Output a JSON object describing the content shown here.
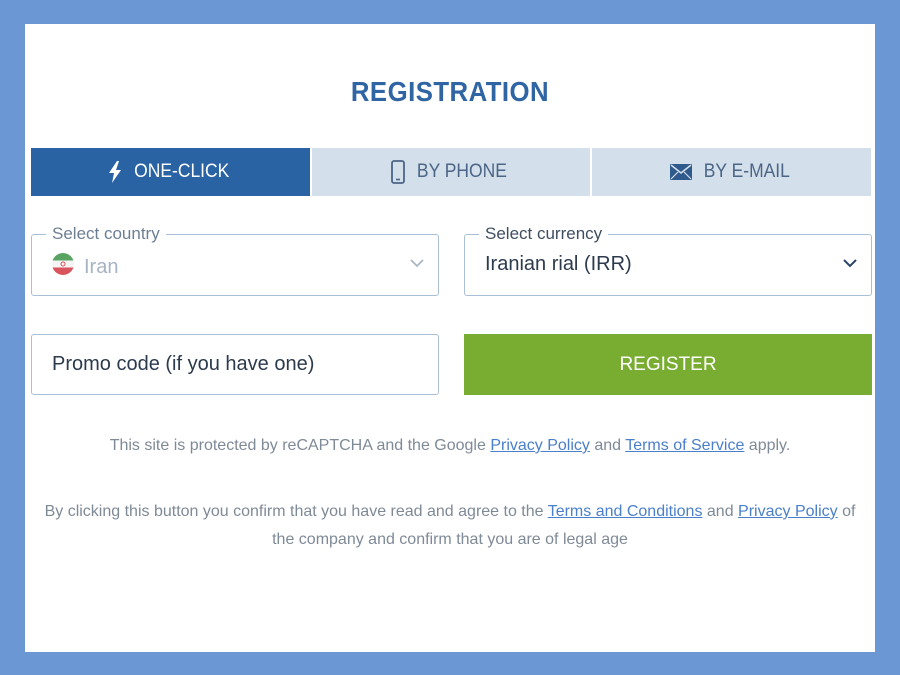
{
  "colors": {
    "page_background": "#6b97d4",
    "title": "#2f65a3",
    "tab_active": "#2963a4",
    "tab_inactive": "#d3dfea",
    "register_button": "#79ad31",
    "link": "#4a7fcb"
  },
  "title": "REGISTRATION",
  "tabs": [
    {
      "label": "ONE-CLICK",
      "icon": "lightning-icon",
      "active": true
    },
    {
      "label": "BY PHONE",
      "icon": "phone-icon",
      "active": false
    },
    {
      "label": "BY E-MAIL",
      "icon": "envelope-icon",
      "active": false
    }
  ],
  "country": {
    "label": "Select country",
    "value": "Iran",
    "icon": "iran-flag-icon"
  },
  "currency": {
    "label": "Select currency",
    "value": "Iranian rial (IRR)"
  },
  "promo": {
    "placeholder": "Promo code (if you have one)"
  },
  "register": {
    "label": "REGISTER"
  },
  "recaptcha_notice": {
    "text_1": "This site is protected by reCAPTCHA and the Google ",
    "link_privacy": "Privacy Policy",
    "text_2": " and ",
    "link_terms": "Terms of Service",
    "text_3": " apply."
  },
  "consent_notice": {
    "text_1": "By clicking this button you confirm that you have read and agree to the ",
    "link_terms": "Terms and Conditions",
    "text_2": " and ",
    "link_privacy": "Privacy Policy",
    "text_3": " of the company and confirm that you are of legal age"
  }
}
